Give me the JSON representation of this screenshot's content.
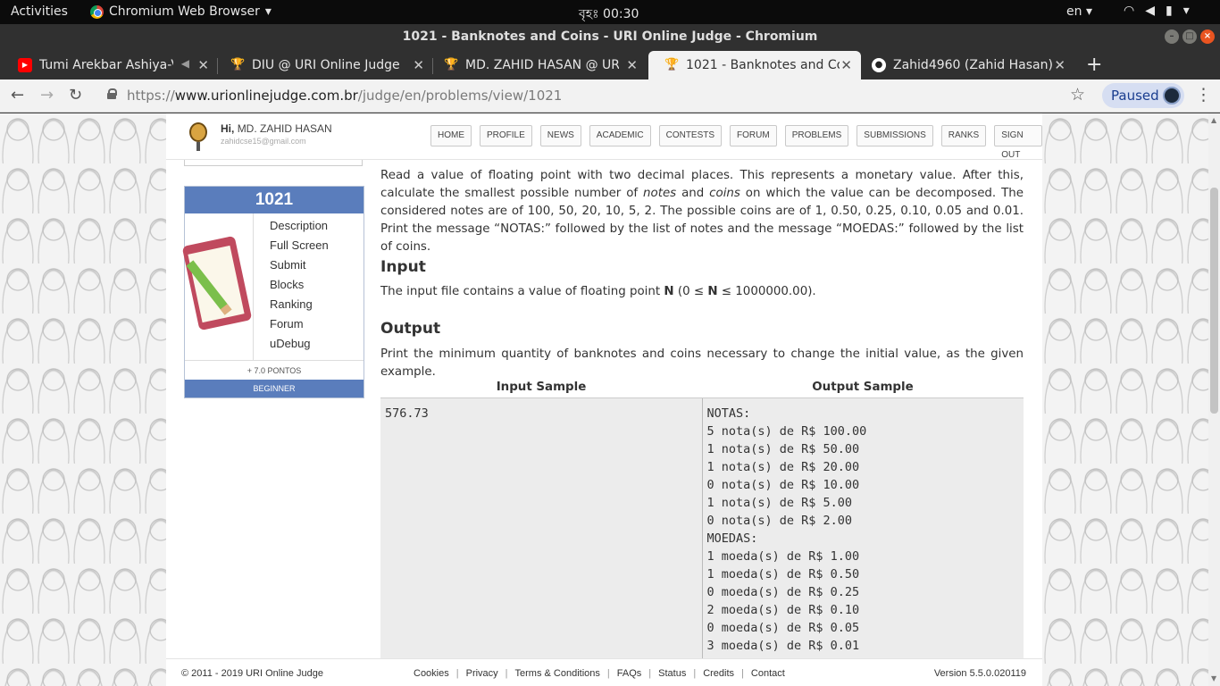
{
  "desktop": {
    "activities": "Activities",
    "app_name": "Chromium Web Browser",
    "clock": "বৃহঃ 00:30",
    "lang": "en"
  },
  "window": {
    "title": "1021 - Banknotes and Coins - URI Online Judge - Chromium"
  },
  "tabs": [
    {
      "label": "Tumi Arekbar Ashiya-V",
      "icon": "youtube-icon"
    },
    {
      "label": "DIU @ URI Online Judge",
      "icon": "trophy-icon"
    },
    {
      "label": "MD. ZAHID HASAN @ URI",
      "icon": "trophy-icon"
    },
    {
      "label": "1021 - Banknotes and Coins",
      "icon": "trophy-icon"
    },
    {
      "label": "Zahid4960 (Zahid Hasan)",
      "icon": "github-icon"
    }
  ],
  "omnibox": {
    "scheme": "https://",
    "host": "www.urionlinejudge.com.br",
    "path": "/judge/en/problems/view/1021",
    "profile_label": "Paused"
  },
  "site_header": {
    "greeting": "Hi,",
    "user": "MD. ZAHID HASAN",
    "email": "zahidcse15@gmail.com",
    "menu": [
      "HOME",
      "PROFILE",
      "NEWS",
      "ACADEMIC",
      "CONTESTS",
      "FORUM",
      "PROBLEMS",
      "SUBMISSIONS",
      "RANKS",
      "SIGN OUT"
    ]
  },
  "problem_box": {
    "number": "1021",
    "links": [
      "Description",
      "Full Screen",
      "Submit",
      "Blocks",
      "Ranking",
      "Forum",
      "uDebug"
    ],
    "points": "+ 7.0 PONTOS",
    "level": "BEGINNER"
  },
  "problem": {
    "desc_1": "Read a value of floating point with two decimal places. This represents a monetary value. After this, calculate the smallest possible number of ",
    "notes": "notes",
    "and": " and ",
    "coins": "coins",
    "desc_2": " on which the value can be decomposed. The considered notes are of 100, 50, 20, 10, 5, 2. The possible coins are of 1, 0.50, 0.25, 0.10, 0.05 and 0.01. Print the message “NOTAS:” followed by the list of notes and the message “MOEDAS:” followed by the list of coins.",
    "input_title": "Input",
    "input_1": "The input file contains a value of floating point ",
    "input_n": "N",
    "input_2": " (0 ≤ ",
    "input_n2": "N",
    "input_3": " ≤ 1000000.00).",
    "output_title": "Output",
    "output_text": "Print the minimum quantity of banknotes and coins necessary to change the initial value, as the given example.",
    "input_sample_header": "Input Sample",
    "output_sample_header": "Output Sample",
    "input_sample": "576.73",
    "output_sample": "NOTAS:\n5 nota(s) de R$ 100.00\n1 nota(s) de R$ 50.00\n1 nota(s) de R$ 20.00\n0 nota(s) de R$ 10.00\n1 nota(s) de R$ 5.00\n0 nota(s) de R$ 2.00\nMOEDAS:\n1 moeda(s) de R$ 1.00\n1 moeda(s) de R$ 0.50\n0 moeda(s) de R$ 0.25\n2 moeda(s) de R$ 0.10\n0 moeda(s) de R$ 0.05\n3 moeda(s) de R$ 0.01"
  },
  "footer": {
    "copyright": "© 2011 - 2019 URI Online Judge",
    "links": [
      "Cookies",
      "Privacy",
      "Terms & Conditions",
      "FAQs",
      "Status",
      "Credits",
      "Contact"
    ],
    "version": "Version 5.5.0.020119"
  }
}
